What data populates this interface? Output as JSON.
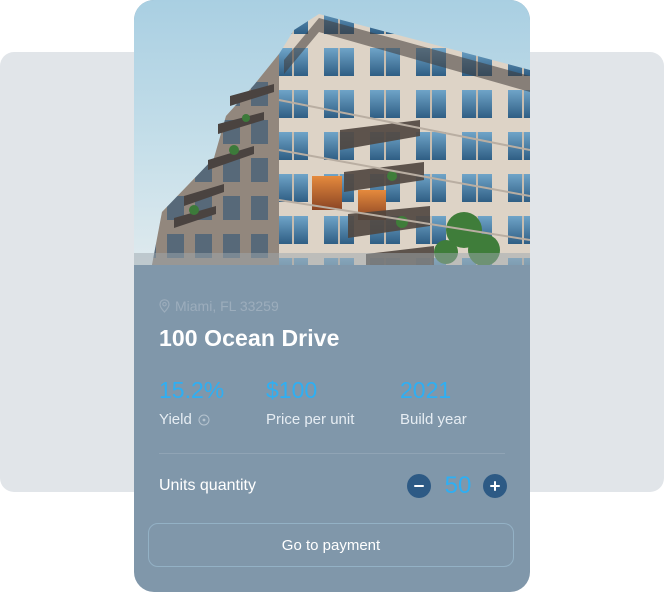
{
  "property": {
    "location": "Miami, FL 33259",
    "title": "100 Ocean Drive",
    "image_icon": "apartment-building-photo"
  },
  "stats": {
    "yield": {
      "value": "15.2%",
      "label": "Yield",
      "icon": "info-icon"
    },
    "price": {
      "value": "$100",
      "label": "Price per unit"
    },
    "build_year": {
      "value": "2021",
      "label": "Build year"
    }
  },
  "quantity": {
    "label": "Units quantity",
    "value": "50",
    "decrement_icon": "minus-icon",
    "increment_icon": "plus-icon"
  },
  "actions": {
    "payment_label": "Go to payment"
  },
  "colors": {
    "card_bg": "#8097aa",
    "accent": "#2eaff3",
    "stepper_button": "#2d5a85",
    "back_panel": "#e1e5e9"
  }
}
